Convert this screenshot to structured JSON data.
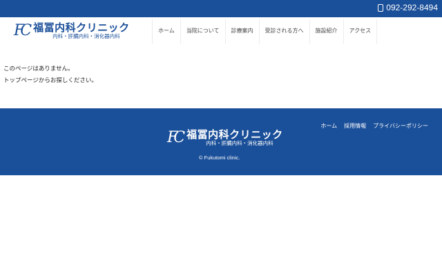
{
  "header": {
    "phone": "092-292-8494",
    "logo_name": "福冨内科クリニック",
    "logo_sub": "内科・肝臓内科・消化器内科",
    "logo_mono": "FC"
  },
  "nav": [
    "ホーム",
    "当院について",
    "診療案内",
    "受診される方へ",
    "施設紹介",
    "アクセス"
  ],
  "main": {
    "line1": "このページはありません。",
    "line2": "トップページからお探しください。"
  },
  "footer": {
    "links": [
      "ホーム",
      "採用情報",
      "プライバシーポリシー"
    ],
    "copyright": "© Fukutomi clinic."
  }
}
